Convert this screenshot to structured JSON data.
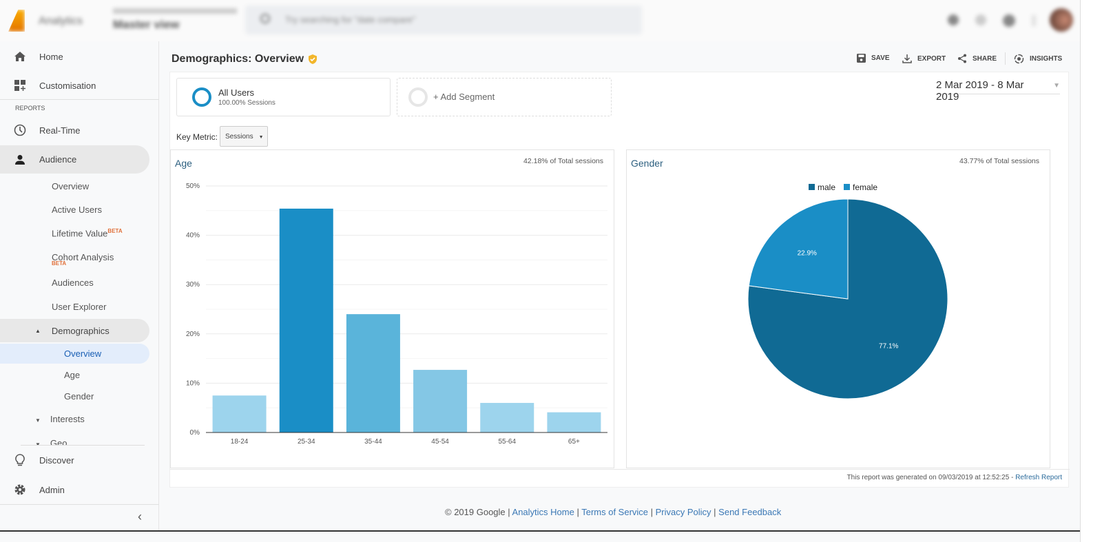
{
  "topbar": {
    "app_name": "Analytics",
    "view_name": "Master view",
    "search_placeholder": "Try searching for \"date compare\""
  },
  "sidebar": {
    "home": "Home",
    "customisation": "Customisation",
    "reports_label": "REPORTS",
    "realtime": "Real-Time",
    "audience": "Audience",
    "audience_items": [
      "Overview",
      "Active Users",
      "Lifetime Value",
      "Cohort Analysis",
      "Audiences",
      "User Explorer"
    ],
    "beta": "BETA",
    "demographics": "Demographics",
    "demo_items": [
      "Overview",
      "Age",
      "Gender"
    ],
    "interests": "Interests",
    "geo": "Geo",
    "discover": "Discover",
    "admin": "Admin"
  },
  "page": {
    "title": "Demographics: Overview",
    "actions": {
      "save": "SAVE",
      "export": "EXPORT",
      "share": "SHARE",
      "insights": "INSIGHTS"
    },
    "segment": {
      "name": "All Users",
      "sub": "100.00% Sessions",
      "add": "+ Add Segment"
    },
    "date_range": "2 Mar 2019 - 8 Mar 2019",
    "key_metric_label": "Key Metric:",
    "key_metric_value": "Sessions",
    "footer_note": "This report was generated on 09/03/2019 at 12:52:25 - ",
    "refresh": "Refresh Report"
  },
  "colors": {
    "accent": "#1a8ec6",
    "male": "#106a94",
    "female": "#1a8ec6",
    "title_blue": "#2c5f7f"
  },
  "chart_data": [
    {
      "type": "bar",
      "title": "Age",
      "summary": "42.18% of Total sessions",
      "categories": [
        "18-24",
        "25-34",
        "35-44",
        "45-54",
        "55-64",
        "65+"
      ],
      "values": [
        7.5,
        45.4,
        24.0,
        12.7,
        6.0,
        4.1
      ],
      "colors": [
        "#9dd4ed",
        "#1a8ec6",
        "#5ab4da",
        "#84c7e5",
        "#9dd4ed",
        "#9dd4ed"
      ],
      "yticks": [
        "0%",
        "10%",
        "20%",
        "30%",
        "40%",
        "50%"
      ],
      "ylim": [
        0,
        50
      ],
      "grid": true
    },
    {
      "type": "pie",
      "title": "Gender",
      "summary": "43.77% of Total sessions",
      "legend": [
        "male",
        "female"
      ],
      "legend_position": "top",
      "values": [
        77.1,
        22.9
      ],
      "labels": [
        "77.1%",
        "22.9%"
      ]
    }
  ],
  "footer": {
    "copyright": "© 2019 Google | ",
    "links": [
      "Analytics Home",
      "Terms of Service",
      "Privacy Policy",
      "Send Feedback"
    ]
  }
}
